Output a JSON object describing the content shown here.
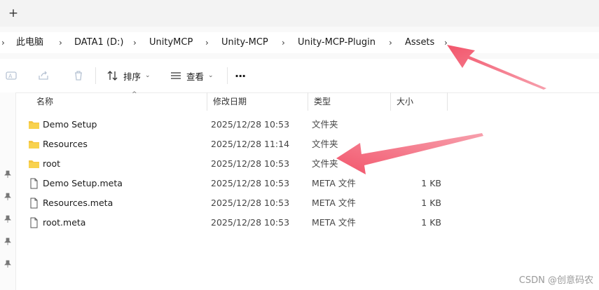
{
  "tabstrip": {
    "new_tab_label": "+"
  },
  "breadcrumb": {
    "items": [
      "此电脑",
      "DATA1 (D:)",
      "UnityMCP",
      "Unity-MCP",
      "Unity-MCP-Plugin",
      "Assets"
    ],
    "separator": "›"
  },
  "toolbar": {
    "sort_label": "排序",
    "view_label": "查看",
    "more_label": "···"
  },
  "columns": {
    "name": "名称",
    "modified": "修改日期",
    "type": "类型",
    "size": "大小"
  },
  "files": [
    {
      "name": "Demo Setup",
      "modified": "2025/12/28 10:53",
      "type": "文件夹",
      "size": "",
      "icon": "folder-icon"
    },
    {
      "name": "Resources",
      "modified": "2025/12/28 11:14",
      "type": "文件夹",
      "size": "",
      "icon": "folder-icon"
    },
    {
      "name": "root",
      "modified": "2025/12/28 10:53",
      "type": "文件夹",
      "size": "",
      "icon": "folder-icon"
    },
    {
      "name": "Demo Setup.meta",
      "modified": "2025/12/28 10:53",
      "type": "META 文件",
      "size": "1 KB",
      "icon": "file-icon"
    },
    {
      "name": "Resources.meta",
      "modified": "2025/12/28 10:53",
      "type": "META 文件",
      "size": "1 KB",
      "icon": "file-icon"
    },
    {
      "name": "root.meta",
      "modified": "2025/12/28 10:53",
      "type": "META 文件",
      "size": "1 KB",
      "icon": "file-icon"
    }
  ],
  "colors": {
    "folder": "#f4c542",
    "arrow": "#f2556b"
  },
  "watermark": "CSDN @创意码农"
}
